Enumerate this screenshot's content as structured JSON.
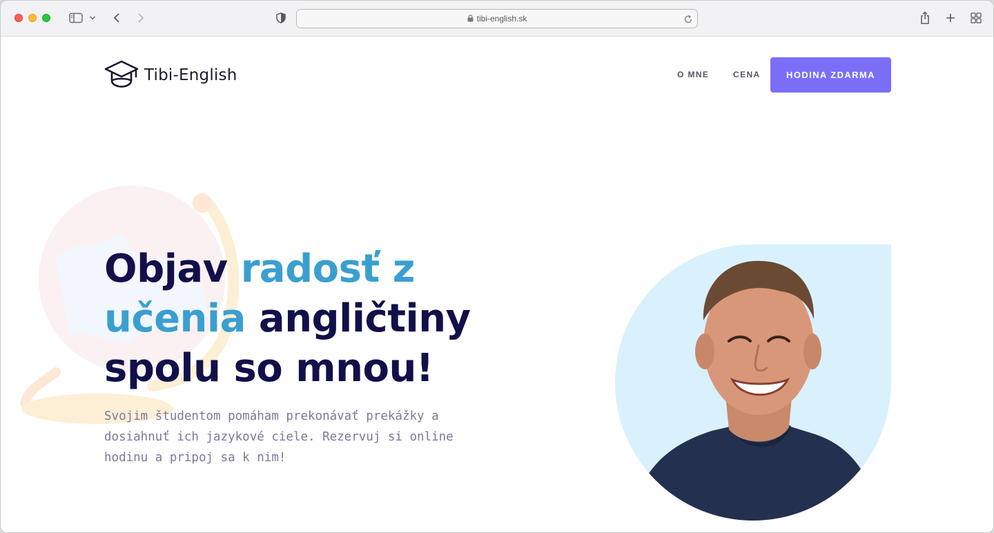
{
  "browser": {
    "url": "tibi-english.sk",
    "icons": [
      "sidebar-icon",
      "chevron-down-icon",
      "back-icon",
      "forward-icon",
      "shield-icon",
      "lock-icon",
      "reload-icon",
      "share-icon",
      "plus-icon",
      "tabs-grid-icon"
    ]
  },
  "header": {
    "logo_text": "Tibi-English",
    "logo_icon": "graduation-cap-icon",
    "nav": [
      {
        "label": "O MNE"
      },
      {
        "label": "CENA"
      }
    ],
    "cta_label": "HODINA ZDARMA"
  },
  "hero": {
    "title_part1": "Objav ",
    "title_highlight": "radosť z učenia",
    "title_part2": " angličtiny spolu so mnou!",
    "subtitle": "Svojim študentom pomáham prekonávať prekážky a dosiahnuť ich jazykové ciele. Rezervuj si online hodinu a pripoj sa k nim!",
    "photo_icon": "portrait-photo",
    "decoration_icon": "globe-icon"
  },
  "colors": {
    "brand_purple": "#7b6ffa",
    "title_navy": "#12104a",
    "highlight_blue": "#3a9fd0",
    "photo_bg": "#d9f1fd"
  }
}
